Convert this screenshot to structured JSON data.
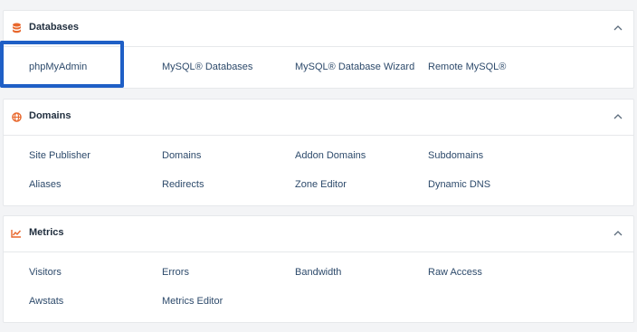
{
  "sections": [
    {
      "title": "Databases",
      "icon": "database-icon",
      "links": [
        "phpMyAdmin",
        "MySQL® Databases",
        "MySQL® Database Wizard",
        "Remote MySQL®"
      ]
    },
    {
      "title": "Domains",
      "icon": "globe-icon",
      "links": [
        "Site Publisher",
        "Domains",
        "Addon Domains",
        "Subdomains",
        "Aliases",
        "Redirects",
        "Zone Editor",
        "Dynamic DNS"
      ]
    },
    {
      "title": "Metrics",
      "icon": "chart-line-icon",
      "links": [
        "Visitors",
        "Errors",
        "Bandwidth",
        "Raw Access",
        "Awstats",
        "Metrics Editor"
      ]
    }
  ],
  "colors": {
    "accent": "#e8672c",
    "link": "#2d4a6b",
    "highlight": "#1f5fc6"
  },
  "highlighted_item": "phpMyAdmin"
}
